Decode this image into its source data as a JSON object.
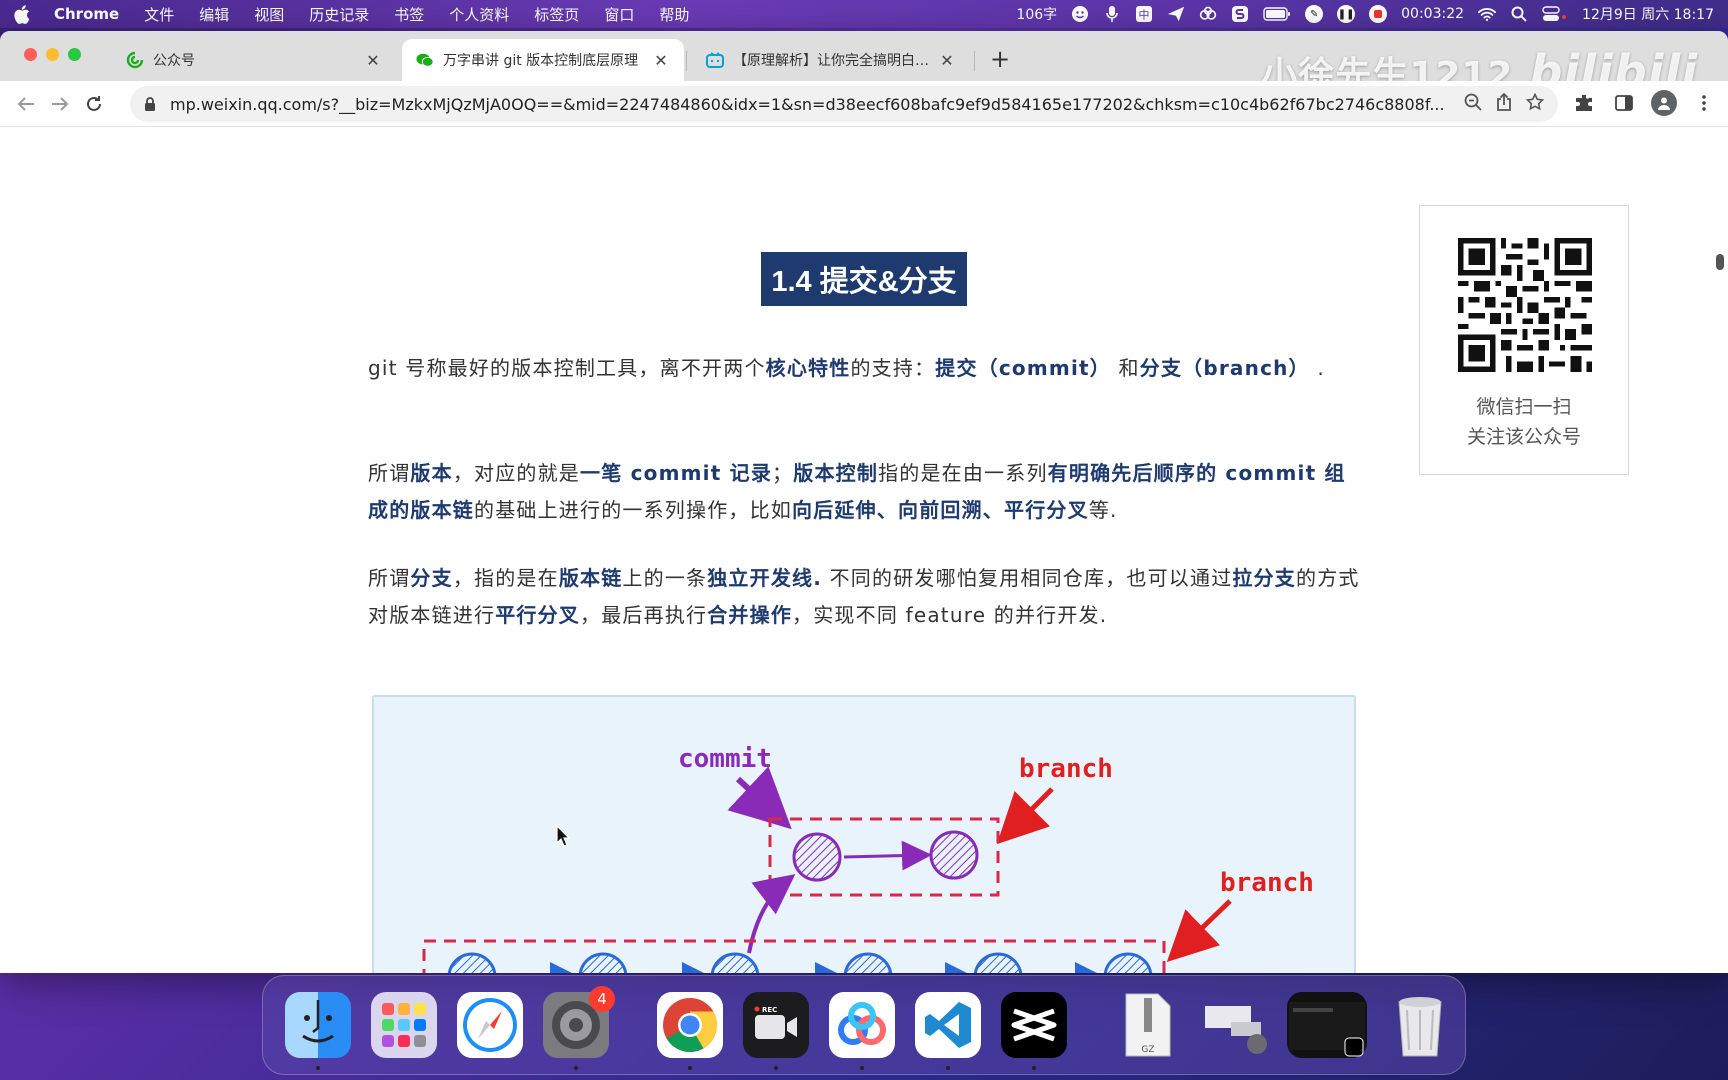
{
  "menubar": {
    "app": "Chrome",
    "items": [
      "文件",
      "编辑",
      "视图",
      "历史记录",
      "书签",
      "个人资料",
      "标签页",
      "窗口",
      "帮助"
    ],
    "word_count": "106字",
    "record_time": "00:03:22",
    "datetime": "12月9日 周六  18:17"
  },
  "tabs": [
    {
      "label": "公众号",
      "icon": "wechat-official-icon",
      "active": false
    },
    {
      "label": "万字串讲 git 版本控制底层原理",
      "icon": "wechat-icon",
      "active": true
    },
    {
      "label": "【原理解析】让你完全搞明白Git",
      "icon": "bilibili-icon",
      "active": false
    }
  ],
  "toolbar": {
    "url": "mp.weixin.qq.com/s?__biz=MzkxMjQzMjA0OQ==&mid=2247484860&idx=1&sn=d38eecf608bafc9ef9d584165e177202&chksm=c10c4b62f67bc2746c8808f..."
  },
  "watermark": {
    "user": "小徐先生1212",
    "site": "bilibili"
  },
  "article": {
    "section_title": "1.4 提交&分支",
    "p1": [
      {
        "t": "git 号称最好的版本控制工具，离不开两个"
      },
      {
        "t": "核心特性",
        "b": true
      },
      {
        "t": "的支持："
      },
      {
        "t": "提交（commit）",
        "b": true
      },
      {
        "t": " 和"
      },
      {
        "t": "分支（branch）",
        "b": true
      },
      {
        "t": " ."
      }
    ],
    "p2": [
      {
        "t": "所谓"
      },
      {
        "t": "版本",
        "b": true
      },
      {
        "t": "，对应的就是"
      },
      {
        "t": "一笔 commit 记录",
        "b": true
      },
      {
        "t": "；"
      },
      {
        "t": "版本控制",
        "b": true
      },
      {
        "t": "指的是在由一系列"
      },
      {
        "t": "有明确先后顺序的 commit 组成的版本链",
        "b": true
      },
      {
        "t": "的基础上进行的一系列操作，比如"
      },
      {
        "t": "向后延伸、向前回溯、平行分叉",
        "b": true
      },
      {
        "t": "等."
      }
    ],
    "p3": [
      {
        "t": "所谓"
      },
      {
        "t": "分支",
        "b": true
      },
      {
        "t": "，指的是在"
      },
      {
        "t": "版本链",
        "b": true
      },
      {
        "t": "上的一条"
      },
      {
        "t": "独立开发线.",
        "b": true
      },
      {
        "t": " 不同的研发哪怕复用相同仓库，也可以通过"
      },
      {
        "t": "拉分支",
        "b": true
      },
      {
        "t": "的方式对版本链进行"
      },
      {
        "t": "平行分叉",
        "b": true
      },
      {
        "t": "，最后再执行"
      },
      {
        "t": "合并操作",
        "b": true
      },
      {
        "t": "，实现不同 feature 的并行开发."
      }
    ],
    "figure": {
      "commit_label": "commit",
      "branch_label_1": "branch",
      "branch_label_2": "branch"
    }
  },
  "qr": {
    "line1": "微信扫一扫",
    "line2": "关注该公众号"
  },
  "dock": {
    "apps": [
      "finder",
      "launchpad",
      "safari",
      "system-settings",
      "chrome",
      "screen-recorder",
      "baidu-netdisk",
      "vscode",
      "capcut"
    ],
    "settings_badge": "4",
    "recorder_label": "REC",
    "file_label": "GZ"
  },
  "colors": {
    "accent": "#1e3a6e",
    "title_bg": "#1e3a6e",
    "commit_purple": "#8a2bb8",
    "branch_red": "#e02020",
    "node_blue": "#2a6ad8"
  }
}
